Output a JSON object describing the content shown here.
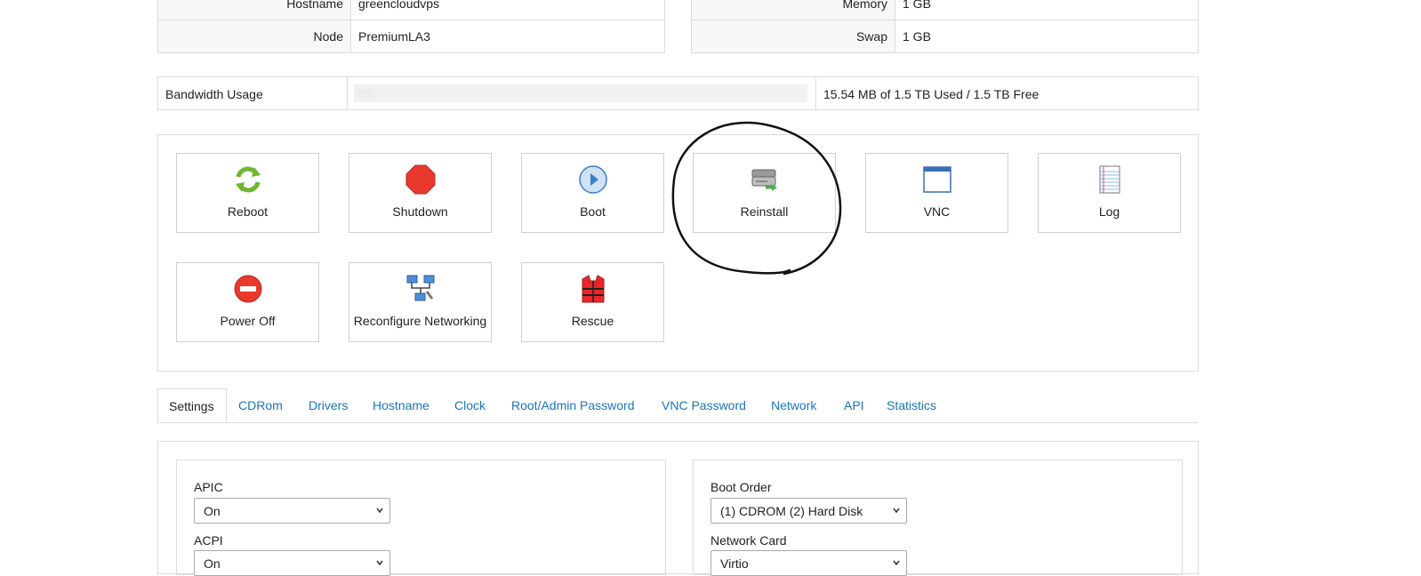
{
  "info_left": [
    {
      "label": "Hostname",
      "value": "greencloudvps"
    },
    {
      "label": "Node",
      "value": "PremiumLA3"
    }
  ],
  "info_right": [
    {
      "label": "Memory",
      "value": "1 GB"
    },
    {
      "label": "Swap",
      "value": "1 GB"
    }
  ],
  "bandwidth": {
    "label": "Bandwidth Usage",
    "percent_text": "0%",
    "percent": 0,
    "summary": "15.54 MB of 1.5 TB Used / 1.5 TB Free"
  },
  "actions": [
    {
      "label": "Reboot",
      "icon": "reboot-icon"
    },
    {
      "label": "Shutdown",
      "icon": "shutdown-icon"
    },
    {
      "label": "Boot",
      "icon": "boot-icon"
    },
    {
      "label": "Reinstall",
      "icon": "reinstall-icon"
    },
    {
      "label": "VNC",
      "icon": "vnc-window-icon"
    },
    {
      "label": "Log",
      "icon": "log-notepad-icon"
    },
    {
      "label": "Power Off",
      "icon": "power-off-icon"
    },
    {
      "label": "Reconfigure Networking",
      "icon": "network-icon"
    },
    {
      "label": "Rescue",
      "icon": "rescue-vest-icon"
    }
  ],
  "tabs": [
    "Settings",
    "CDRom",
    "Drivers",
    "Hostname",
    "Clock",
    "Root/Admin Password",
    "VNC Password",
    "Network",
    "API",
    "Statistics"
  ],
  "active_tab": "Settings",
  "settings_left": [
    {
      "label": "APIC",
      "value": "On"
    },
    {
      "label": "ACPI",
      "value": "On"
    }
  ],
  "settings_right": [
    {
      "label": "Boot Order",
      "value": "(1) CDROM (2) Hard Disk"
    },
    {
      "label": "Network Card",
      "value": "Virtio"
    }
  ],
  "colors": {
    "link": "#1a75bb",
    "border": "#dcdcdc",
    "annotation": "#000000"
  }
}
